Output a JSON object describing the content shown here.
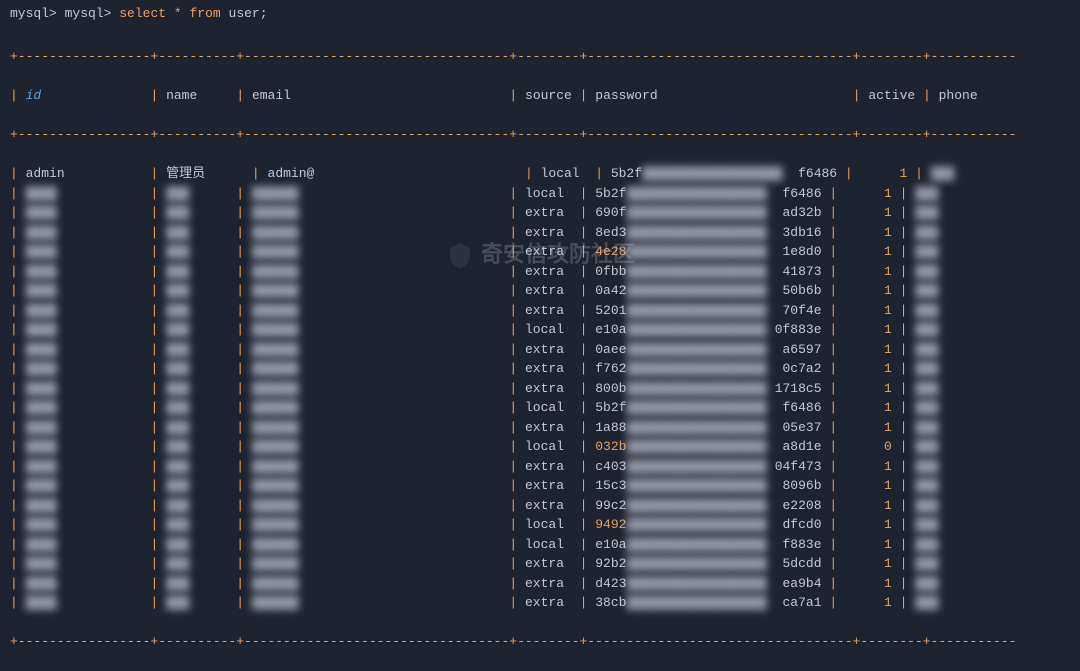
{
  "prompt": {
    "p1": "mysql>",
    "p2": "mysql>",
    "cmd_select": "select",
    "cmd_star": "*",
    "cmd_from": "from",
    "cmd_table": "user;"
  },
  "headers": {
    "id": "id",
    "name": "name",
    "email": "email",
    "source": "source",
    "password": "password",
    "active": "active",
    "phone": "phone"
  },
  "rows": [
    {
      "id": "admin",
      "name": "管理员",
      "email": "admin@",
      "source": "local",
      "pw_start": "5b2f",
      "pw_end": "f6486",
      "active": "1",
      "highlight": false
    },
    {
      "id": "",
      "name": "",
      "email": "",
      "source": "local",
      "pw_start": "5b2f",
      "pw_end": "f6486",
      "active": "1",
      "highlight": false
    },
    {
      "id": "",
      "name": "",
      "email": "",
      "source": "extra",
      "pw_start": "690f",
      "pw_end": "ad32b",
      "active": "1",
      "highlight": false
    },
    {
      "id": "",
      "name": "",
      "email": "",
      "source": "extra",
      "pw_start": "8ed3",
      "pw_end": "3db16",
      "active": "1",
      "highlight": false
    },
    {
      "id": "",
      "name": "",
      "email": "",
      "source": "extra",
      "pw_start": "4e28",
      "pw_end": "1e8d0",
      "active": "1",
      "highlight": true
    },
    {
      "id": "",
      "name": "",
      "email": "",
      "source": "extra",
      "pw_start": "0fbb",
      "pw_end": "41873",
      "active": "1",
      "highlight": false
    },
    {
      "id": "",
      "name": "",
      "email": "",
      "source": "extra",
      "pw_start": "0a42",
      "pw_end": "50b6b",
      "active": "1",
      "highlight": false
    },
    {
      "id": "",
      "name": "",
      "email": "",
      "source": "extra",
      "pw_start": "5201",
      "pw_end": "70f4e",
      "active": "1",
      "highlight": false
    },
    {
      "id": "",
      "name": "",
      "email": "",
      "source": "local",
      "pw_start": "e10a",
      "pw_end": "0f883e",
      "active": "1",
      "highlight": false
    },
    {
      "id": "",
      "name": "",
      "email": "",
      "source": "extra",
      "pw_start": "0aee",
      "pw_end": "a6597",
      "active": "1",
      "highlight": false
    },
    {
      "id": "",
      "name": "",
      "email": "",
      "source": "extra",
      "pw_start": "f762",
      "pw_end": "0c7a2",
      "active": "1",
      "highlight": false
    },
    {
      "id": "",
      "name": "",
      "email": "",
      "source": "extra",
      "pw_start": "800b",
      "pw_end": "1718c5",
      "active": "1",
      "highlight": false
    },
    {
      "id": "",
      "name": "",
      "email": "",
      "source": "local",
      "pw_start": "5b2f",
      "pw_end": "f6486",
      "active": "1",
      "highlight": false
    },
    {
      "id": "",
      "name": "",
      "email": "",
      "source": "extra",
      "pw_start": "1a88",
      "pw_end": "05e37",
      "active": "1",
      "highlight": false
    },
    {
      "id": "",
      "name": "",
      "email": "",
      "source": "local",
      "pw_start": "032b",
      "pw_end": "a8d1e",
      "active": "0",
      "highlight": true
    },
    {
      "id": "",
      "name": "",
      "email": "",
      "source": "extra",
      "pw_start": "c403",
      "pw_end": "04f473",
      "active": "1",
      "highlight": false
    },
    {
      "id": "",
      "name": "",
      "email": "",
      "source": "extra",
      "pw_start": "15c3",
      "pw_end": "8096b",
      "active": "1",
      "highlight": false
    },
    {
      "id": "",
      "name": "",
      "email": "",
      "source": "extra",
      "pw_start": "99c2",
      "pw_end": "e2208",
      "active": "1",
      "highlight": false
    },
    {
      "id": "",
      "name": "",
      "email": "",
      "source": "local",
      "pw_start": "9492",
      "pw_end": "dfcd0",
      "active": "1",
      "highlight": true
    },
    {
      "id": "",
      "name": "",
      "email": "",
      "source": "local",
      "pw_start": "e10a",
      "pw_end": "f883e",
      "active": "1",
      "highlight": false
    },
    {
      "id": "",
      "name": "",
      "email": "",
      "source": "extra",
      "pw_start": "92b2",
      "pw_end": "5dcdd",
      "active": "1",
      "highlight": false
    },
    {
      "id": "",
      "name": "",
      "email": "",
      "source": "extra",
      "pw_start": "d423",
      "pw_end": "ea9b4",
      "active": "1",
      "highlight": false
    },
    {
      "id": "",
      "name": "",
      "email": "",
      "source": "extra",
      "pw_start": "38cb",
      "pw_end": "ca7a1",
      "active": "1",
      "highlight": false
    }
  ],
  "watermark": "奇安信攻防社区",
  "border": {
    "top": "+-----------------+----------+----------------------------------+--------+----------------------------------+--------+-----------",
    "bottom": "+-----------------+----------+----------------------------------+--------+----------------------------------+--------+-----------"
  }
}
